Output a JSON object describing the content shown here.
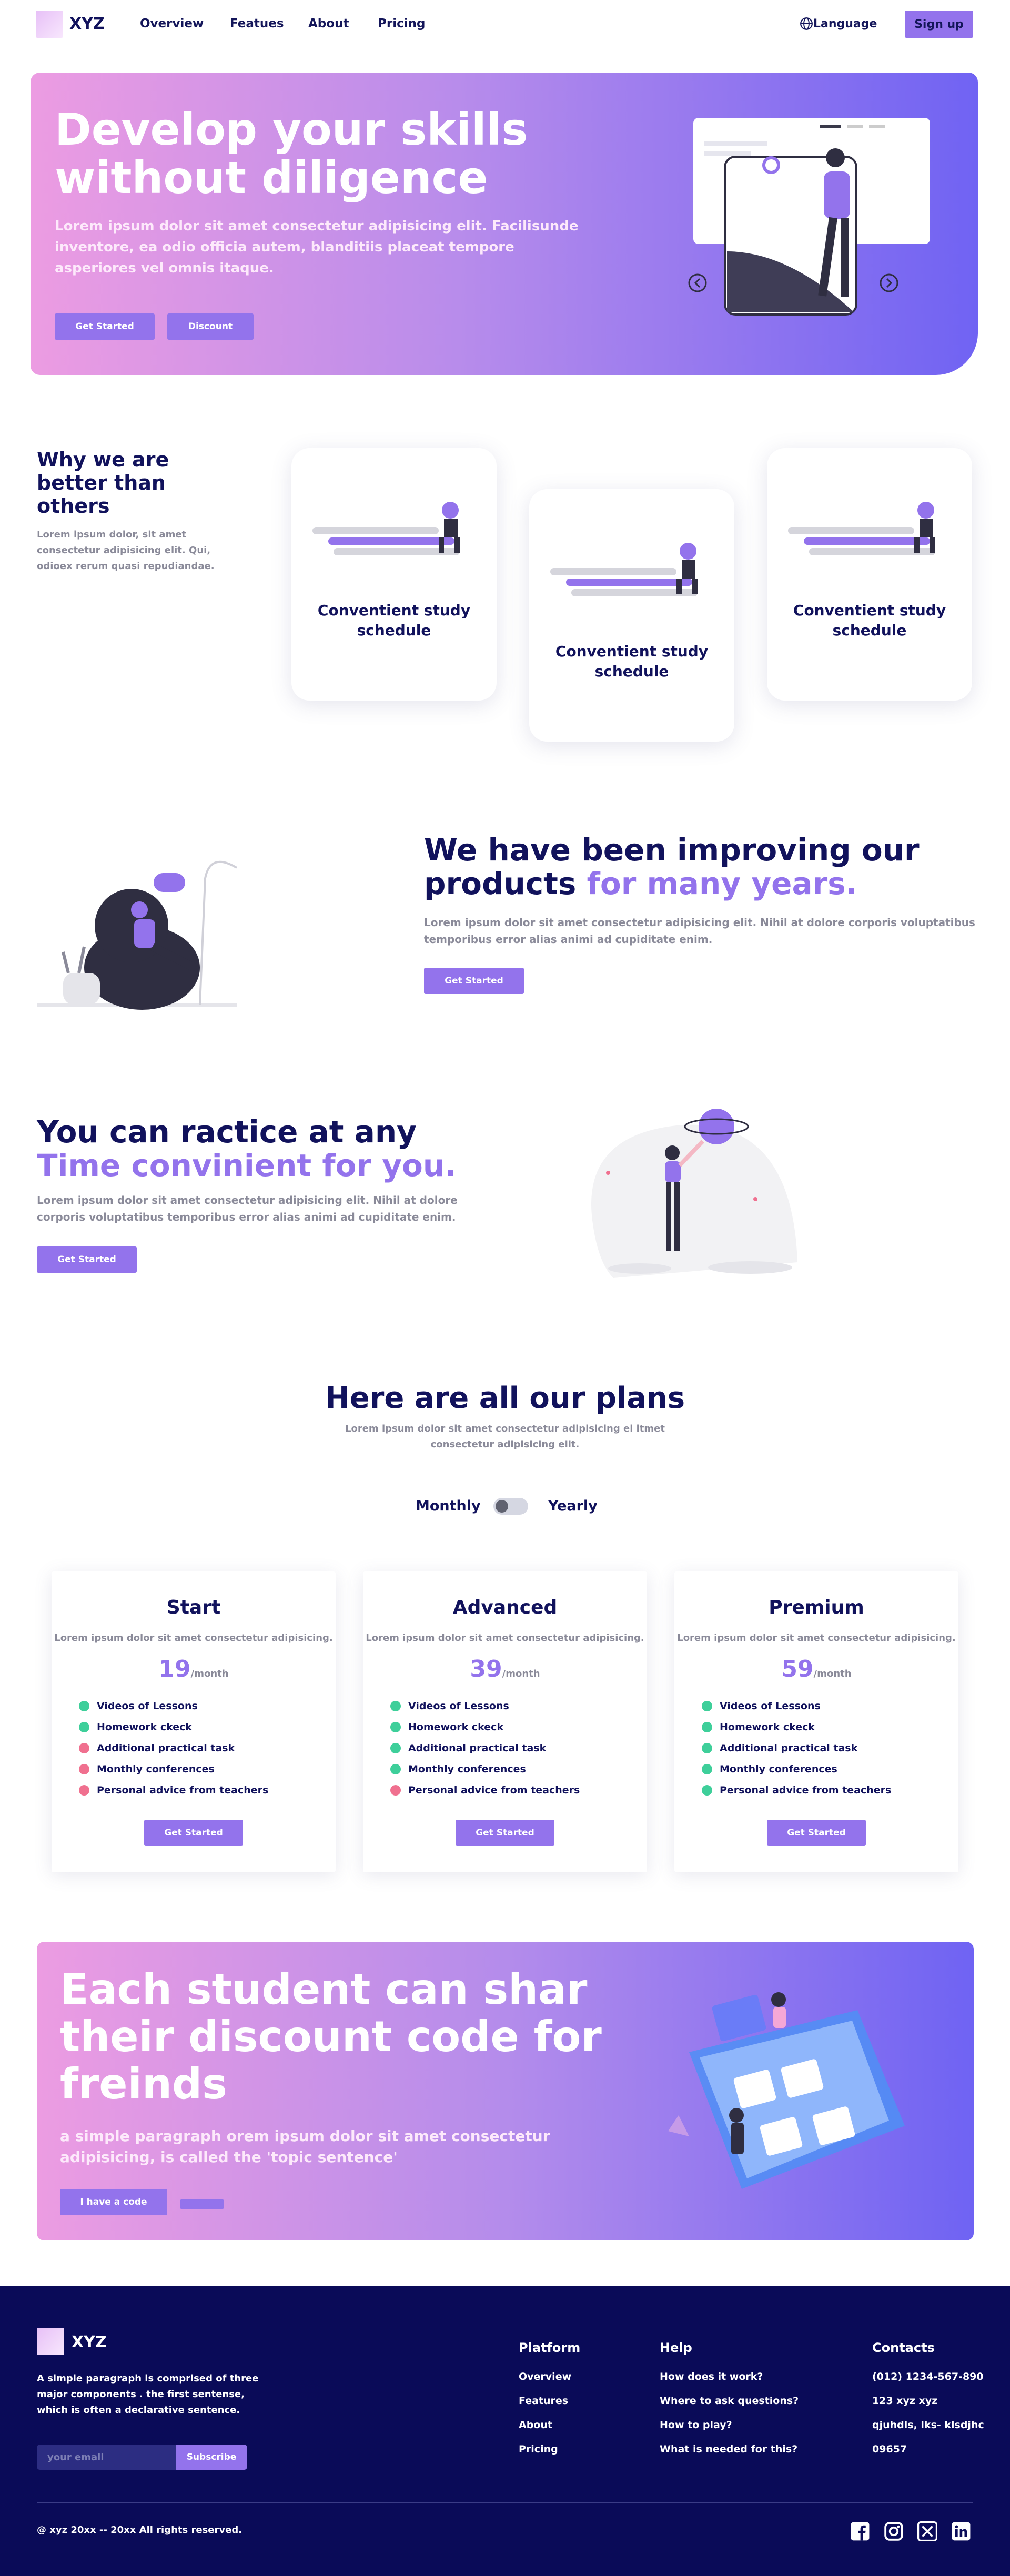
{
  "header": {
    "brand": "XYZ",
    "nav": [
      "Overview",
      "Featues",
      "About",
      "Pricing"
    ],
    "language": "Language",
    "signup": "Sign up"
  },
  "hero": {
    "title_line1": "Develop your skills",
    "title_line2": "without diligence",
    "subtitle": "Lorem ipsum dolor sit amet consectetur adipisicing elit. Facilisunde inventore, ea odio officia autem, blanditiis placeat tempore asperiores vel omnis itaque.",
    "cta_primary": "Get Started",
    "cta_secondary": "Discount"
  },
  "why": {
    "title": "Why we are better than others",
    "text": "Lorem ipsum dolor, sit amet consectetur adipisicing elit. Qui, odioex rerum quasi repudiandae.",
    "cards": [
      {
        "title": "Conventient study schedule"
      },
      {
        "title": "Conventient study schedule"
      },
      {
        "title": "Conventient study schedule"
      }
    ]
  },
  "improving": {
    "title_plain": "We have been improving our products",
    "title_accent": "for many years.",
    "text": "Lorem ipsum dolor sit amet consectetur adipisicing elit. Nihil at dolore corporis voluptatibus temporibus error alias animi ad cupiditate enim.",
    "cta": "Get Started"
  },
  "practice": {
    "title_plain": "You can ractice at any",
    "title_accent_1": "Time",
    "title_accent_2": "convinient for you.",
    "text": "Lorem ipsum dolor sit amet consectetur adipisicing elit. Nihil at dolore corporis voluptatibus temporibus error alias animi ad cupiditate enim.",
    "cta": "Get Started"
  },
  "plans": {
    "title": "Here are all our plans",
    "subtitle_line1": "Lorem ipsum dolor sit amet consectetur adipisicing el itmet",
    "subtitle_line2": "consectetur adipisicing elit.",
    "toggle_monthly": "Monthly",
    "toggle_yearly": "Yearly",
    "items": [
      {
        "name": "Start",
        "desc": "Lorem ipsum dolor sit amet consectetur adipisicing.",
        "price": "19",
        "period": "/month",
        "features": [
          {
            "label": "Videos of Lessons",
            "included": true
          },
          {
            "label": "Homework ckeck",
            "included": true
          },
          {
            "label": "Additional practical task",
            "included": false
          },
          {
            "label": "Monthly conferences",
            "included": false
          },
          {
            "label": "Personal advice from teachers",
            "included": false
          }
        ],
        "cta": "Get Started"
      },
      {
        "name": "Advanced",
        "desc": "Lorem ipsum dolor sit amet consectetur adipisicing.",
        "price": "39",
        "period": "/month",
        "features": [
          {
            "label": "Videos of Lessons",
            "included": true
          },
          {
            "label": "Homework ckeck",
            "included": true
          },
          {
            "label": "Additional practical task",
            "included": true
          },
          {
            "label": "Monthly conferences",
            "included": true
          },
          {
            "label": "Personal advice from teachers",
            "included": false
          }
        ],
        "cta": "Get Started"
      },
      {
        "name": "Premium",
        "desc": "Lorem ipsum dolor sit amet consectetur adipisicing.",
        "price": "59",
        "period": "/month",
        "features": [
          {
            "label": "Videos of Lessons",
            "included": true
          },
          {
            "label": "Homework ckeck",
            "included": true
          },
          {
            "label": "Additional practical task",
            "included": true
          },
          {
            "label": "Monthly conferences",
            "included": true
          },
          {
            "label": "Personal advice from teachers",
            "included": true
          }
        ],
        "cta": "Get Started"
      }
    ]
  },
  "discount": {
    "title_line1": "Each student can shar",
    "title_line2": "their discount code for",
    "title_line3": "freinds",
    "text": "a simple paragraph orem ipsum dolor sit amet consectetur adipisicing, is called the 'topic sentence'",
    "cta": "I have a code"
  },
  "footer": {
    "brand": "XYZ",
    "about": "A simple paragraph is comprised of three major components . the first sentense, which is often a declarative sentence.",
    "email_placeholder": "your email",
    "subscribe": "Subscribe",
    "platform": {
      "title": "Platform",
      "links": [
        "Overview",
        "Features",
        "About",
        "Pricing"
      ]
    },
    "help": {
      "title": "Help",
      "links": [
        "How does it work?",
        "Where to ask questions?",
        "How to play?",
        "What is needed for this?"
      ]
    },
    "contacts": {
      "title": "Contacts",
      "items": [
        "(012) 1234-567-890",
        "123 xyz xyz",
        "qjuhdls, lks- klsdjhc",
        "09657"
      ]
    },
    "copyright": "@ xyz 20xx -- 20xx All rights reserved.",
    "social": [
      "facebook-icon",
      "instagram-icon",
      "x-icon",
      "linkedin-icon"
    ]
  },
  "colors": {
    "accent": "#9373ec",
    "navy": "#11125c",
    "footer_bg": "#0a0b58",
    "included": "#3ecf9a",
    "excluded": "#f0708f"
  }
}
